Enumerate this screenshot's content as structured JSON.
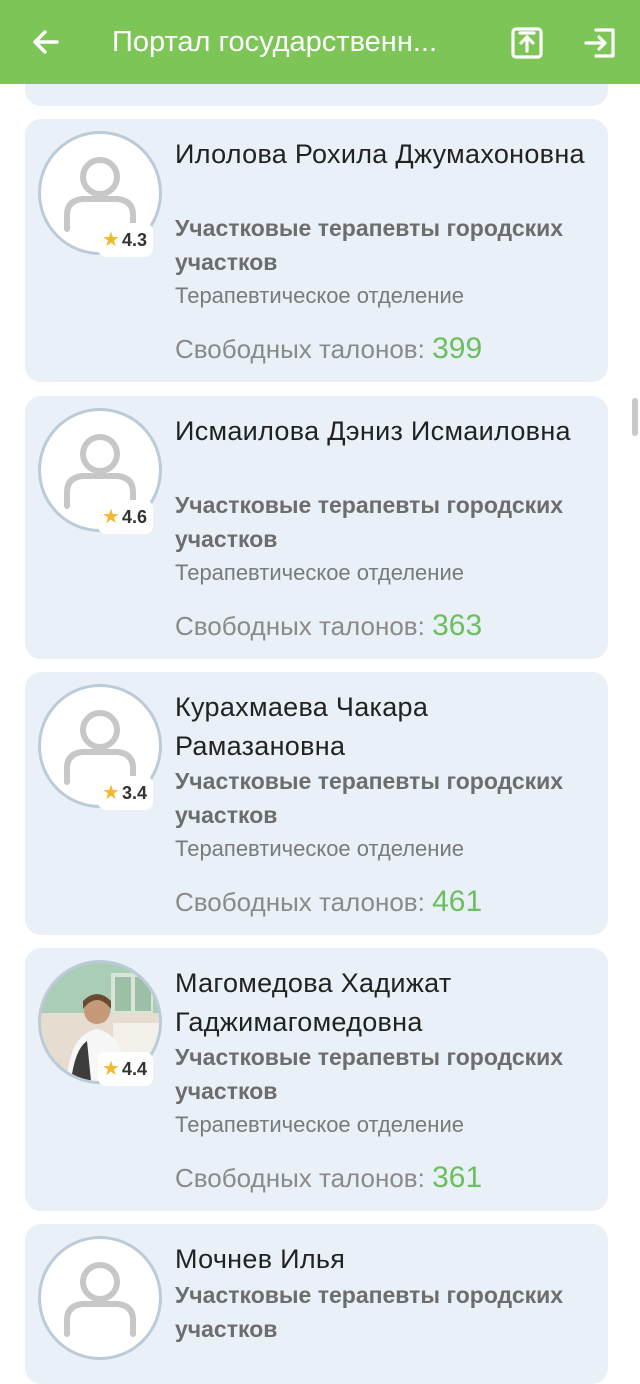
{
  "app_bar": {
    "title": "Портал государственн...",
    "back_icon": "arrow-left-icon",
    "share_icon": "share-upload-icon",
    "logout_icon": "logout-icon"
  },
  "doctors": [
    {
      "name": "Илолова Рохила Джумахоновна",
      "specialty": "Участковые терапевты городских участков",
      "department": "Терапевтическое отделение",
      "tickets_label": "Свободных талонов:",
      "tickets": "399",
      "rating": "4.3",
      "avatar": "placeholder"
    },
    {
      "name": "Исмаилова Дэниз Исмаиловна",
      "specialty": "Участковые терапевты городских участков",
      "department": "Терапевтическое отделение",
      "tickets_label": "Свободных талонов:",
      "tickets": "363",
      "rating": "4.6",
      "avatar": "placeholder"
    },
    {
      "name": "Курахмаева Чакара Рамазановна",
      "specialty": "Участковые терапевты городских участков",
      "department": "Терапевтическое отделение",
      "tickets_label": "Свободных талонов:",
      "tickets": "461",
      "rating": "3.4",
      "avatar": "placeholder"
    },
    {
      "name": "Магомедова Хадижат Гаджимагомедовна",
      "specialty": "Участковые терапевты городских участков",
      "department": "Терапевтическое отделение",
      "tickets_label": "Свободных талонов:",
      "tickets": "361",
      "rating": "4.4",
      "avatar": "photo"
    },
    {
      "name": "Мочнев Илья",
      "specialty": "Участковые терапевты городских участков",
      "department": "",
      "tickets_label": "",
      "tickets": "",
      "rating": "",
      "avatar": "placeholder"
    }
  ],
  "colors": {
    "app_bar": "#7cc556",
    "card": "#e9f0f7",
    "tickets_number": "#6cbf5e",
    "star": "#f2b92b"
  }
}
